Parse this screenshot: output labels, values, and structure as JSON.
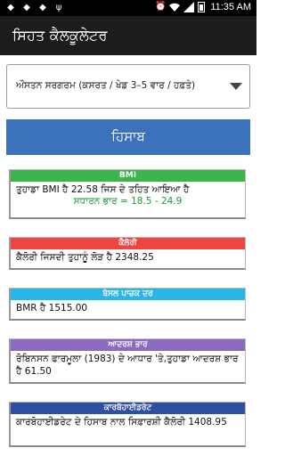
{
  "status_bar": {
    "time": "11:35 AM",
    "left_icons": [
      "notification-icon",
      "notification-icon",
      "notification-icon",
      "usb-icon"
    ],
    "right_icons": [
      "alarm-icon",
      "wifi-icon",
      "signal-icon",
      "battery-icon"
    ]
  },
  "app_bar": {
    "title": "ਸਿਹਤ ਕੈਲਕੂਲੇਟਰ"
  },
  "activity_select": {
    "value": "ਔਸਤਨ ਸਰਗਰਮ (ਕਸਰਤ / ਖੇਡ 3–5 ਵਾਰ / ਹਫ਼ਤੇ)"
  },
  "calculate_button": {
    "label": "ਹਿਸਾਬ",
    "color": "#3a73bb"
  },
  "cards": {
    "bmi": {
      "title": "BMI",
      "color": "#39b54a",
      "text": "ਤੁਹਾਡਾ BMI ਹੈ  22.58  ਜਿਸ ਦੇ ਤਹਿਤ ਆਇਆ ਹੈ",
      "category": "ਸਧਾਰਨ ਭਾਰ = 18.5 - 24.9",
      "category_color": "#1a9b34"
    },
    "calorie": {
      "title": "ਕੈਲੋਰੀ",
      "color": "#ee4540",
      "text": "ਕੈਲੋਰੀ ਜਿਸਦੀ ਤੁਹਾਨੂੰ ਲੋੜ ਹੈ  2348.25"
    },
    "bmr": {
      "title": "ਬੇਸਲ ਪਾਚਕ ਦਰ",
      "color": "#29b6e8",
      "text": "BMR ਹੈ  1515.00"
    },
    "ideal_weight": {
      "title": "ਆਦਰਸ਼ ਭਾਰ",
      "color": "#8a6bbf",
      "text": "ਰੋਬਿਨਸਨ ਫਾਰਮੂਲਾ (1983) ਦੇ ਆਧਾਰ 'ਤੇ,ਤੁਹਾਡਾ ਆਦਰਸ਼ ਭਾਰ ਹੈ  61.50"
    },
    "carbohydrate": {
      "title": "ਕਾਰਬੋਹਾਈਡਰੇਟ",
      "color": "#2f4fa3",
      "text": "ਕਾਰਬੋਹਾਈਡਰੇਟ ਦੇ ਹਿਸਾਬ ਨਾਲ ਸਿਫ਼ਾਰਸ਼ੀ ਕੈਲੋਰੀ 1408.95"
    }
  }
}
